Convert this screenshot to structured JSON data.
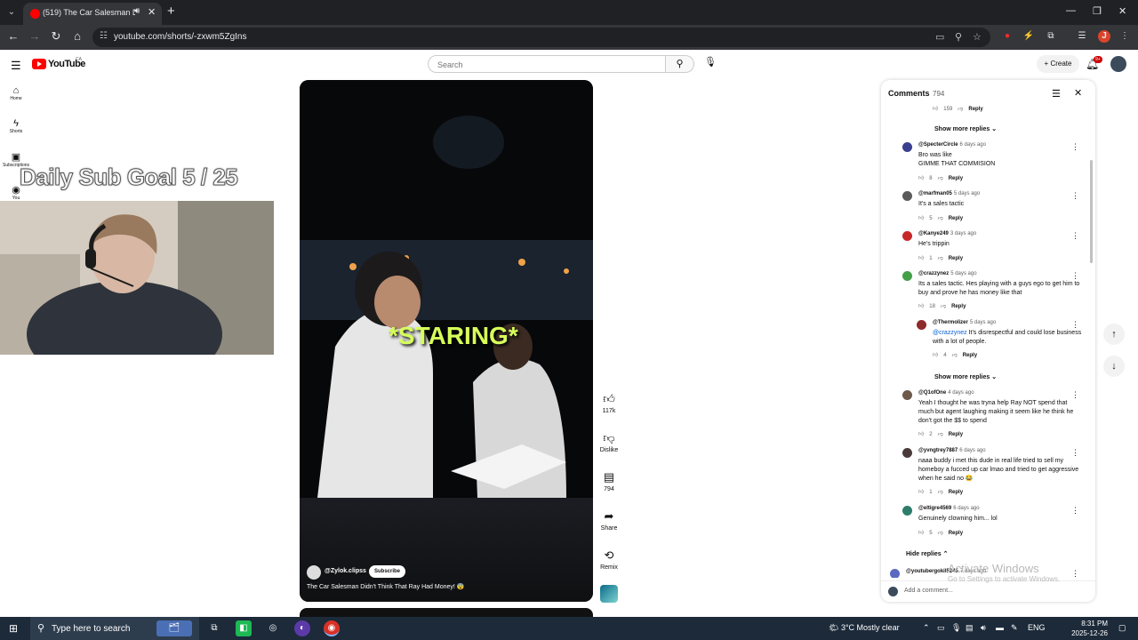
{
  "browser": {
    "tab_title": "(519) The Car Salesman Didn't",
    "url": "youtube.com/shorts/-zxwm5ZgIns"
  },
  "header": {
    "logo_text": "YouTube",
    "country": "CA",
    "search_placeholder": "Search",
    "create_label": "Create",
    "notification_count": "9+"
  },
  "guide": [
    {
      "label": "Home",
      "icon": "home-icon"
    },
    {
      "label": "Shorts",
      "icon": "shorts-icon"
    },
    {
      "label": "Subscriptions",
      "icon": "subscriptions-icon"
    },
    {
      "label": "You",
      "icon": "you-icon"
    }
  ],
  "overlay": {
    "goal_text": "Daily Sub Goal  5 / 25"
  },
  "video": {
    "caption": "*STARING*",
    "channel": "@Zylok.clipss",
    "subscribe_label": "Subscribe",
    "title": "The Car Salesman Didn't Think That Ray Had Money! 😨"
  },
  "actions": {
    "likes": "117k",
    "dislike": "Dislike",
    "comments": "794",
    "share": "Share",
    "remix": "Remix"
  },
  "comments_panel": {
    "title": "Comments",
    "count": "794",
    "top_reply_likes": "159",
    "show_more_replies": "Show more replies",
    "hide_replies": "Hide replies",
    "reply_label": "Reply",
    "add_comment_placeholder": "Add a comment...",
    "items": [
      {
        "handle": "@SpecterCircle",
        "time": "6 days ago",
        "text": "Bro was like\nGIMME THAT COMMISION",
        "likes": "8",
        "color": "#3a3f8f"
      },
      {
        "handle": "@marfman05",
        "time": "5 days ago",
        "text": "It's a sales tactic",
        "likes": "5",
        "color": "#5a5a5a"
      },
      {
        "handle": "@Kanye249",
        "time": "3 days ago",
        "text": "He's trippin",
        "likes": "1",
        "color": "#c62828"
      },
      {
        "handle": "@crazzynez",
        "time": "5 days ago",
        "text": "Its a sales tactic. Hes playing with a guys ego to get him to buy and prove he has money like that",
        "likes": "18",
        "color": "#43a047"
      },
      {
        "handle": "@Thermolizer",
        "time": "5 days ago",
        "mention": "@crazzynez",
        "text": " It's disrespectful and could lose business with a lot of people.",
        "likes": "4",
        "color": "#8e2a2a"
      },
      {
        "handle": "@Q1ofOne",
        "time": "4 days ago",
        "text": "Yeah I thought he was tryna help Ray NOT spend that much but agent laughing making it seem like he think he don't got the $$ to spend",
        "likes": "2",
        "color": "#6d5a4a"
      },
      {
        "handle": "@yvngtrey7887",
        "time": "6 days ago",
        "text": "naaa buddy i met this dude in real life tried to sell my homeboy a fucced up car lmao and tried to get aggressive when he said no 😂",
        "likes": "1",
        "color": "#4a3a3a"
      },
      {
        "handle": "@eltigre4569",
        "time": "6 days ago",
        "text": "Genuinely clowning him... lol",
        "likes": "5",
        "color": "#2e7d6b"
      },
      {
        "handle": "@youtubergokil5245",
        "time": "7 days ago",
        "text": "",
        "likes": "",
        "color": "#5c6bc0"
      }
    ]
  },
  "watermark": {
    "title": "Activate Windows",
    "subtitle": "Go to Settings to activate Windows."
  },
  "taskbar": {
    "search_placeholder": "Type here to search",
    "weather": "3°C  Mostly clear",
    "language": "ENG",
    "time": "8:31 PM",
    "date": "2025-12-26"
  }
}
